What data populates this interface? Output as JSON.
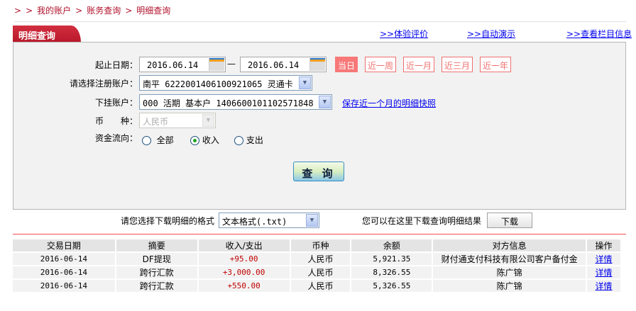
{
  "breadcrumb": [
    ">",
    ">",
    "我的账户",
    ">",
    "账务查询",
    ">",
    "明细查询"
  ],
  "tab_title": "明细查询",
  "top_links": [
    ">>体验评价",
    ">>自动演示",
    ">>查看栏目信息"
  ],
  "form": {
    "date_label": "起止日期：",
    "start_date": "2016.06.14",
    "dash": "—",
    "end_date": "2016.06.14",
    "quick_ranges": [
      "当日",
      "近一周",
      "近一月",
      "近三月",
      "近一年"
    ],
    "quick_active": "当日",
    "reg_account_label": "请选择注册账户：",
    "reg_account_value": "南平 6222001406100921065 灵通卡",
    "sub_account_label": "下挂账户：",
    "sub_account_value": "000 活期 基本户 1406600101102571848",
    "snapshot_link": "保存近一个月的明细快照",
    "currency_label": "币　　种：",
    "currency_value": "人民币",
    "flow_label": "资金流向：",
    "flow_options": [
      "全部",
      "收入",
      "支出"
    ],
    "flow_selected": "收入",
    "search_button": "查 询"
  },
  "download": {
    "format_label": "请您选择下载明细的格式",
    "format_value": "文本格式(.txt)",
    "hint": "您可以在这里下载查询明细结果",
    "button": "下载"
  },
  "table": {
    "headers": [
      "交易日期",
      "摘要",
      "收入/支出",
      "币种",
      "余额",
      "对方信息",
      "操作"
    ],
    "rows": [
      [
        "2016-06-14",
        "DF提现",
        "+95.00",
        "人民币",
        "5,921.35",
        "财付通支付科技有限公司客户备付金",
        "详情"
      ],
      [
        "2016-06-14",
        "跨行汇款",
        "+3,000.00",
        "人民币",
        "8,326.55",
        "陈广锦",
        "详情"
      ],
      [
        "2016-06-14",
        "跨行汇款",
        "+550.00",
        "人民币",
        "5,326.55",
        "陈广锦",
        "详情"
      ]
    ]
  },
  "colors": {
    "accent": "#b8182a",
    "quick_button": "#f07070",
    "amount": "#c00000",
    "link": "#0000ee"
  }
}
